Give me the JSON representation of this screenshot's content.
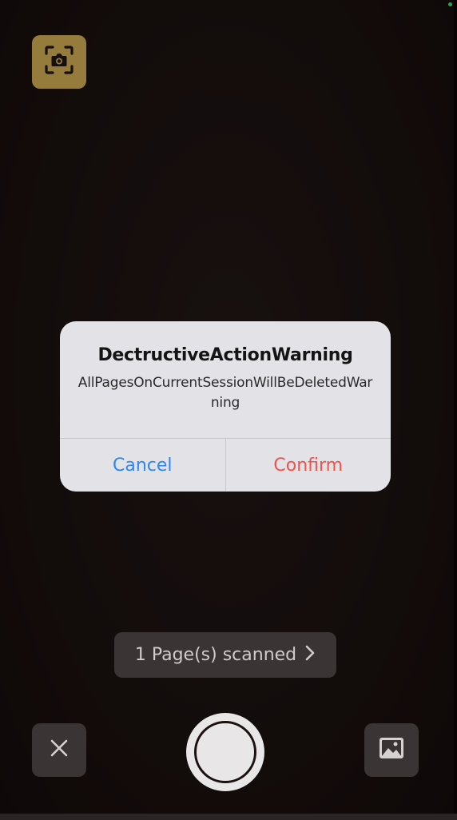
{
  "icons": {
    "document_detect": "document-scan-camera-icon",
    "close": "close-x-icon",
    "gallery": "photo-gallery-icon",
    "chevron": "chevron-right-icon"
  },
  "colors": {
    "doc_button": "#b8984a",
    "cancel": "#2e86f0",
    "confirm": "#f0524c",
    "alert_bg": "#e3e2e6"
  },
  "alert": {
    "title": "DectructiveActionWarning",
    "message": "AllPagesOnCurrentSessionWillBeDeletedWarning",
    "cancel_label": "Cancel",
    "confirm_label": "Confirm"
  },
  "scan": {
    "pages_label": "1 Page(s) scanned"
  }
}
